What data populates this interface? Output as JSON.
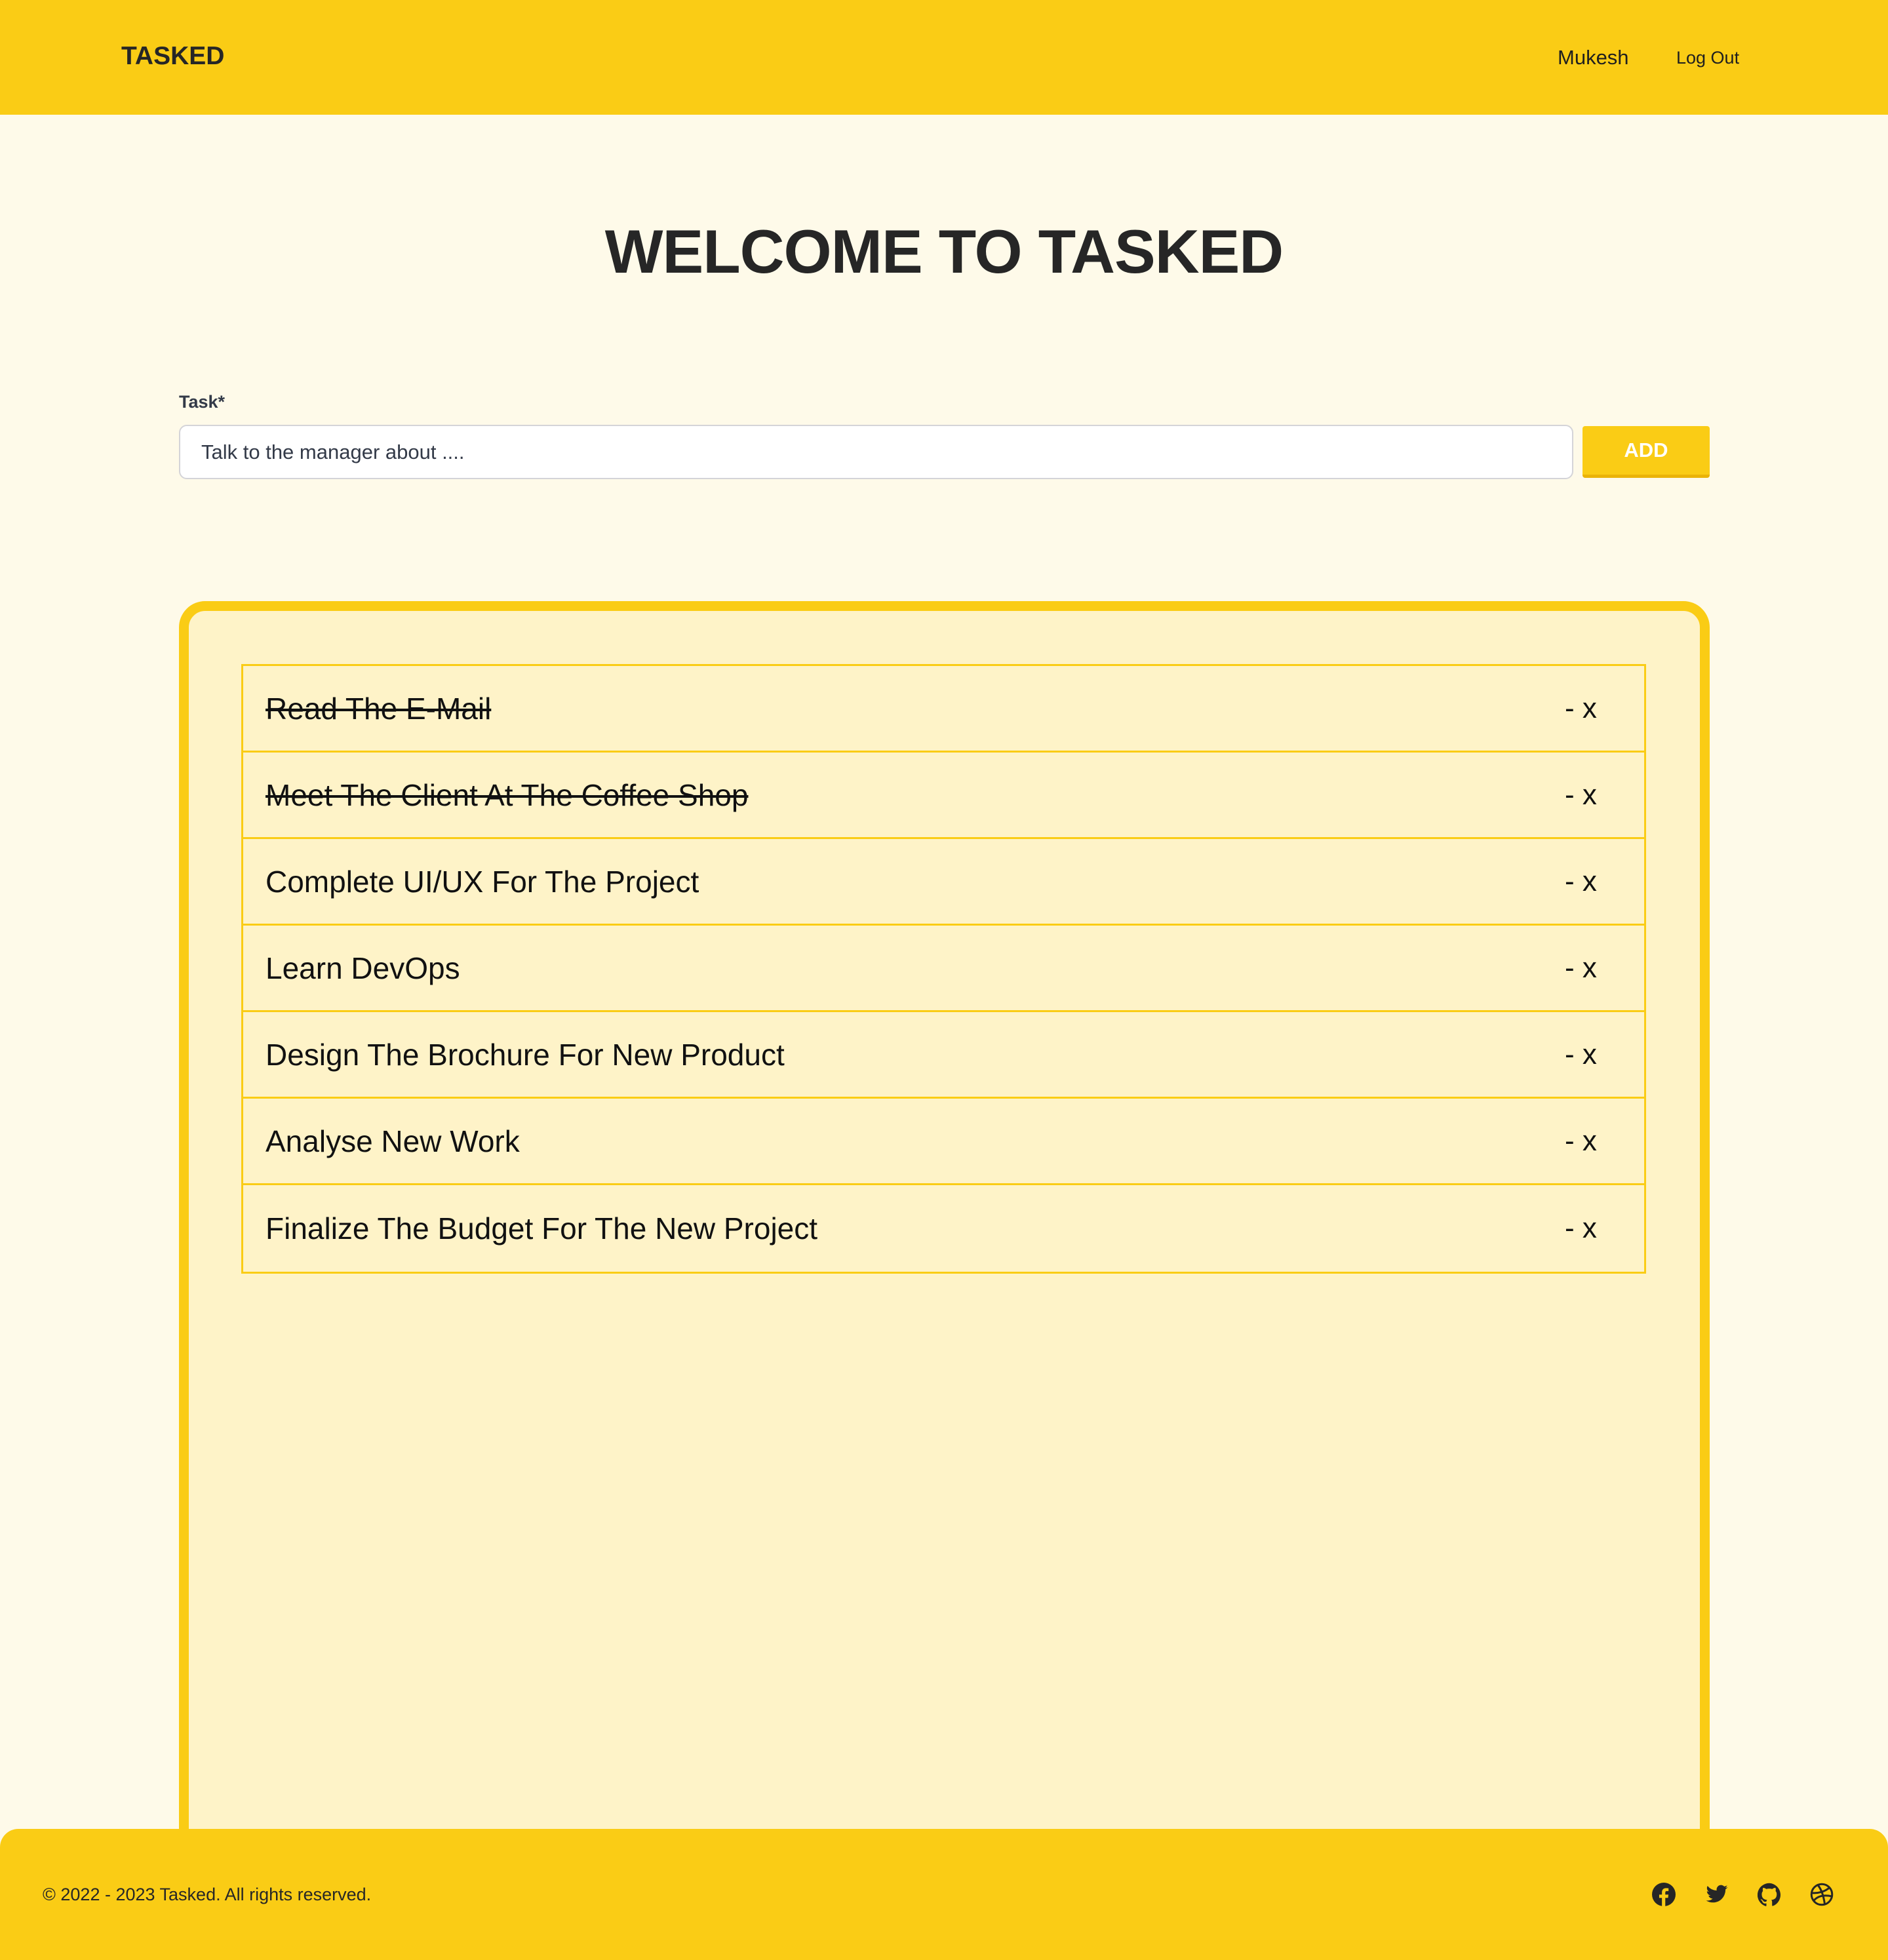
{
  "header": {
    "logo": "TASKED",
    "user": "Mukesh",
    "logout": "Log Out"
  },
  "main": {
    "title": "WELCOME TO TASKED",
    "task_label": "Task*",
    "task_placeholder": "Talk to the manager about ....",
    "add_label": "ADD"
  },
  "tasks": [
    {
      "text": "Read The E-Mail",
      "done": true,
      "remove": "- x"
    },
    {
      "text": "Meet The Client At The Coffee Shop",
      "done": true,
      "remove": "- x"
    },
    {
      "text": "Complete UI/UX For The Project",
      "done": false,
      "remove": "- x"
    },
    {
      "text": "Learn DevOps",
      "done": false,
      "remove": "- x"
    },
    {
      "text": "Design The Brochure For New Product",
      "done": false,
      "remove": "- x"
    },
    {
      "text": "Analyse New Work",
      "done": false,
      "remove": "- x"
    },
    {
      "text": "Finalize The Budget For The New Project",
      "done": false,
      "remove": "- x"
    }
  ],
  "footer": {
    "copyright": "© 2022 - 2023 Tasked. All rights reserved.",
    "icons": [
      "facebook-icon",
      "twitter-icon",
      "github-icon",
      "dribbble-icon"
    ]
  },
  "colors": {
    "accent": "#facc15",
    "background": "#fefae9",
    "card": "#fef3c8"
  }
}
